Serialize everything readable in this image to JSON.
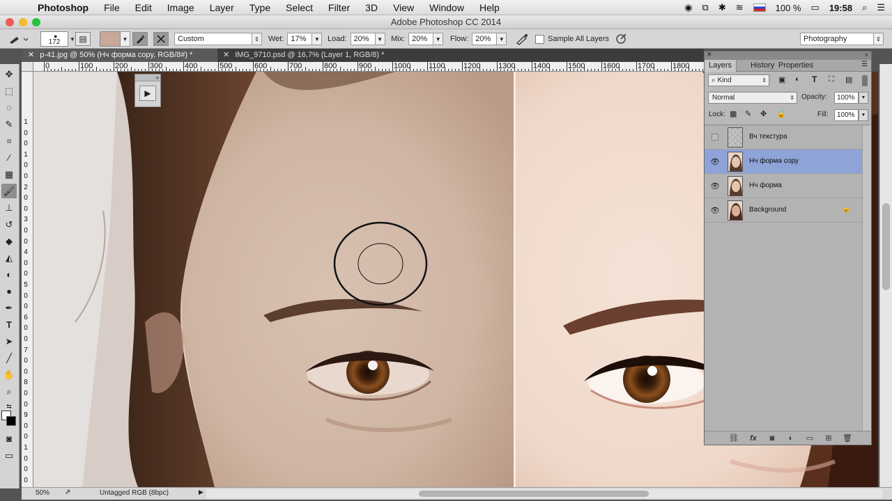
{
  "menubar": {
    "apple": "",
    "items": [
      "Photoshop",
      "File",
      "Edit",
      "Image",
      "Layer",
      "Type",
      "Select",
      "Filter",
      "3D",
      "View",
      "Window",
      "Help"
    ],
    "battery": "100 %",
    "time": "19:58"
  },
  "window": {
    "title": "Adobe Photoshop CC 2014"
  },
  "options": {
    "brush_size": "172",
    "mode": "Custom",
    "wet_label": "Wet:",
    "wet_value": "17%",
    "load_label": "Load:",
    "load_value": "20%",
    "mix_label": "Mix:",
    "mix_value": "20%",
    "flow_label": "Flow:",
    "flow_value": "20%",
    "sample_all_layers": "Sample All Layers",
    "workspace": "Photography"
  },
  "tabs": [
    {
      "label": "p-41.jpg @ 50% (Нч форма copy, RGB/8#) *",
      "active": true
    },
    {
      "label": "IMG_9710.psd @ 16,7% (Layer 1, RGB/8) *",
      "active": false
    }
  ],
  "ruler": {
    "top_labels": [
      "0",
      "100",
      "200",
      "300",
      "400",
      "500",
      "600",
      "700",
      "800",
      "900",
      "1000",
      "1100",
      "1200",
      "1300",
      "1400",
      "1500",
      "1600",
      "1700",
      "1800"
    ],
    "left_labels": [
      "1",
      "0",
      "0",
      "1",
      "0",
      "0",
      "2",
      "0",
      "0",
      "3",
      "0",
      "0",
      "4",
      "0",
      "0",
      "5",
      "0",
      "0",
      "6",
      "0",
      "0",
      "7",
      "0",
      "0",
      "8",
      "0",
      "0",
      "9",
      "0",
      "0",
      "1",
      "0",
      "0",
      "0"
    ]
  },
  "panel": {
    "tabs": [
      "Layers",
      "History",
      "Properties"
    ],
    "filter_kind": "Kind",
    "blend_mode": "Normal",
    "opacity_label": "Opacity:",
    "opacity_value": "100%",
    "lock_label": "Lock:",
    "fill_label": "Fill:",
    "fill_value": "100%",
    "layers": [
      {
        "name": "Вч текстура",
        "visible": false,
        "selected": false,
        "locked": false
      },
      {
        "name": "Нч форма copy",
        "visible": true,
        "selected": true,
        "locked": false
      },
      {
        "name": "Нч форма",
        "visible": true,
        "selected": false,
        "locked": false
      },
      {
        "name": "Background",
        "visible": true,
        "selected": false,
        "locked": true
      }
    ],
    "footer_icons": [
      "link-icon",
      "fx-icon",
      "mask-icon",
      "adjustment-icon",
      "folder-icon",
      "new-layer-icon",
      "trash-icon"
    ]
  },
  "status": {
    "zoom": "50%",
    "profile": "Untagged RGB (8bpc)"
  },
  "colors": {
    "selected_layer": "#8ea3d8",
    "swatch_fg": "#c8a898"
  }
}
